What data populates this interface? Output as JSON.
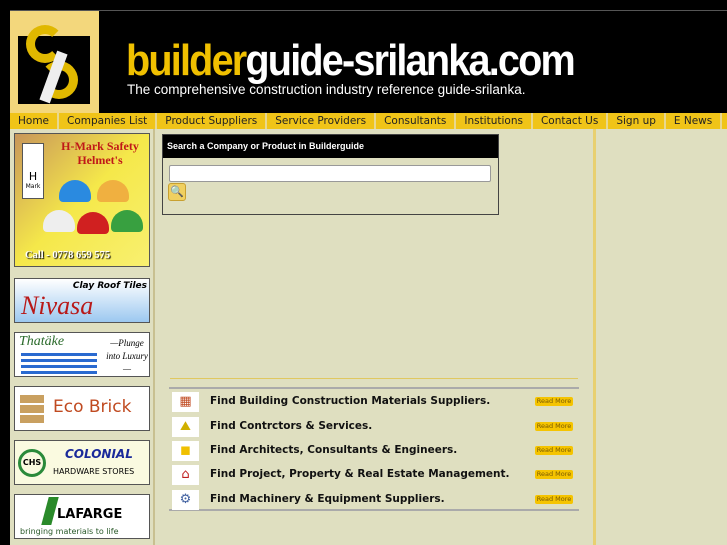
{
  "header": {
    "title_part1": "builder",
    "title_part2": "guide-srilanka.com",
    "tagline": "The comprehensive construction industry reference guide-srilanka."
  },
  "nav": [
    "Home",
    "Companies List",
    "Product Suppliers",
    "Service Providers",
    "Consultants",
    "Institutions",
    "Contact Us",
    "Sign up",
    "E News"
  ],
  "ads": [
    {
      "title": "H-Mark Safety Helmet's",
      "mark": "H",
      "mark_sub": "Mark",
      "phone": "Call - 0778 659 575"
    },
    {
      "brand": "Nivasa",
      "tag": "Clay Roof Tiles"
    },
    {
      "brand": "Thatäke",
      "tag": "—Plunge into Luxury—"
    },
    {
      "brand": "Eco Brick"
    },
    {
      "brand": "COLONIAL",
      "sub": "HARDWARE STORES",
      "logo": "CHS"
    },
    {
      "brand": "LAFARGE",
      "tag": "bringing materials to life"
    }
  ],
  "search": {
    "heading": "Search a Company or Product in Builderguide",
    "value": "",
    "placeholder": ""
  },
  "links": [
    {
      "icon": "bricks-icon",
      "text": "Find Building Construction Materials Suppliers.",
      "more": "Read More"
    },
    {
      "icon": "bulldozer-icon",
      "text": "Find Contrctors & Services.",
      "more": "Read More"
    },
    {
      "icon": "hard-hat-icon",
      "text": "Find Architects, Consultants & Engineers.",
      "more": "Read More"
    },
    {
      "icon": "house-icon",
      "text": "Find Project, Property & Real Estate Management.",
      "more": "Read More"
    },
    {
      "icon": "machinery-icon",
      "text": "Find Machinery & Equipment Suppliers.",
      "more": "Read More"
    }
  ],
  "colors": {
    "accent": "#f0c418",
    "background": "#dfdfc0"
  }
}
